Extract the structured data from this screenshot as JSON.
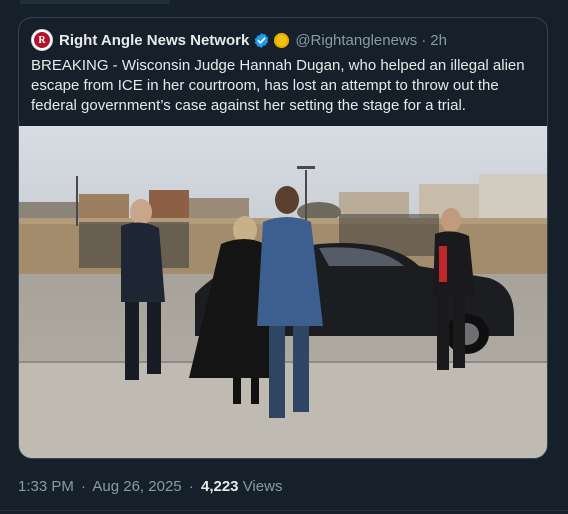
{
  "quoted_tweet": {
    "display_name": "Right Angle News Network",
    "handle": "@Rightanglenews",
    "separator": "·",
    "time_ago": "2h",
    "avatar_letter": "R",
    "text": "BREAKING - Wisconsin Judge Hannah Dugan, who helped an illegal alien escape from ICE in her courtroom, has lost an attempt to throw out the federal government’s case against her setting the stage for a trial.",
    "colors": {
      "accent_verified": "#1d9bf0",
      "badge_gold": "#f4c20d",
      "brand_red": "#b3122b"
    }
  },
  "footer": {
    "time": "1:33 PM",
    "separator": "·",
    "date": "Aug 26, 2025",
    "views_count": "4,223",
    "views_label": "Views"
  },
  "icons": [
    "verified-badge-icon",
    "gold-badge-icon"
  ]
}
